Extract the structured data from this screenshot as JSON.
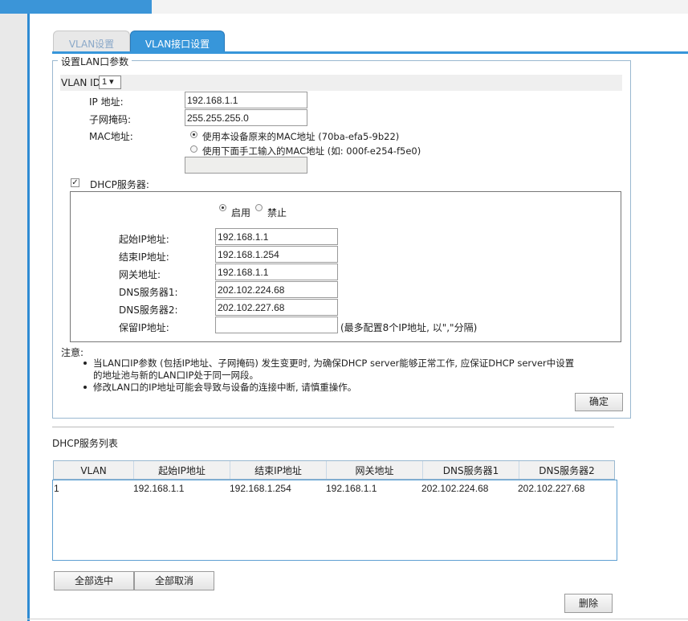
{
  "tabs": [
    "VLAN设置",
    "VLAN接口设置"
  ],
  "section_legend": "设置LAN口参数",
  "vlan": {
    "label": "VLAN ID",
    "value": "1 ▾"
  },
  "ip": {
    "label": "IP 地址:",
    "value": "192.168.1.1"
  },
  "mask": {
    "label": "子网掩码:",
    "value": "255.255.255.0"
  },
  "mac": {
    "label": "MAC地址:",
    "option_original": "使用本设备原来的MAC地址 (70ba-efa5-9b22)",
    "option_manual": "使用下面手工输入的MAC地址 (如: 000f-e254-f5e0)",
    "manual_value": ""
  },
  "dhcp": {
    "checkbox_label": "DHCP服务器:",
    "checked": true,
    "enable_label": "启用",
    "disable_label": "禁止",
    "start_label": "起始IP地址:",
    "start_value": "192.168.1.1",
    "end_label": "结束IP地址:",
    "end_value": "192.168.1.254",
    "gateway_label": "网关地址:",
    "gateway_value": "192.168.1.1",
    "dns1_label": "DNS服务器1:",
    "dns1_value": "202.102.224.68",
    "dns2_label": "DNS服务器2:",
    "dns2_value": "202.102.227.68",
    "reserved_label": "保留IP地址:",
    "reserved_value": "",
    "reserved_hint": "(最多配置8个IP地址, 以\",\"分隔)"
  },
  "notes": {
    "title": "注意:",
    "line1a": "当LAN口IP参数 (包括IP地址、子网掩码) 发生变更时, 为确保DHCP server能够正常工作, 应保证DHCP server中设置",
    "line1b": "的地址池与新的LAN口IP处于同一网段。",
    "line2": "修改LAN口的IP地址可能会导致与设备的连接中断, 请慎重操作。"
  },
  "confirm_button": "确定",
  "list": {
    "title": "DHCP服务列表",
    "columns": [
      "VLAN",
      "起始IP地址",
      "结束IP地址",
      "网关地址",
      "DNS服务器1",
      "DNS服务器2"
    ],
    "rows": [
      [
        "1",
        "192.168.1.1",
        "192.168.1.254",
        "192.168.1.1",
        "202.102.224.68",
        "202.102.227.68"
      ]
    ]
  },
  "select_all_button": "全部选中",
  "deselect_all_button": "全部取消",
  "delete_button": "删除"
}
